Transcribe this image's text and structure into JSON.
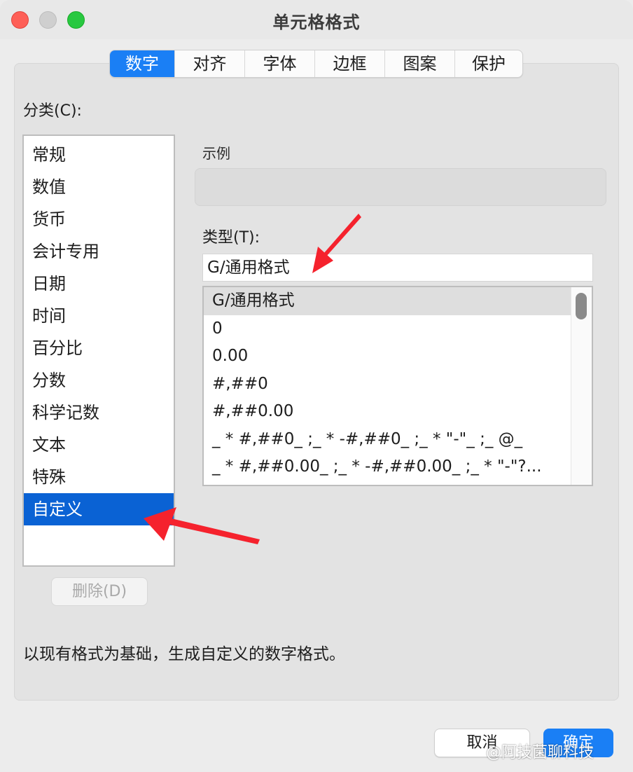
{
  "window": {
    "title": "单元格格式"
  },
  "tabs": [
    {
      "label": "数字",
      "active": true
    },
    {
      "label": "对齐",
      "active": false
    },
    {
      "label": "字体",
      "active": false
    },
    {
      "label": "边框",
      "active": false
    },
    {
      "label": "图案",
      "active": false
    },
    {
      "label": "保护",
      "active": false
    }
  ],
  "category": {
    "label": "分类(C):",
    "items": [
      "常规",
      "数值",
      "货币",
      "会计专用",
      "日期",
      "时间",
      "百分比",
      "分数",
      "科学记数",
      "文本",
      "特殊",
      "自定义"
    ],
    "selected_index": 11,
    "delete_label": "删除(D)"
  },
  "sample": {
    "label": "示例",
    "value": ""
  },
  "type": {
    "label": "类型(T):",
    "input_value": "G/通用格式",
    "items": [
      "G/通用格式",
      "0",
      "0.00",
      "#,##0",
      "#,##0.00",
      "_ * #,##0_ ;_ * -#,##0_ ;_ * \"-\"_ ;_ @_",
      "_ * #,##0.00_ ;_ * -#,##0.00_ ;_ * \"-\"?..."
    ],
    "selected_index": 0
  },
  "description": "以现有格式为基础，生成自定义的数字格式。",
  "buttons": {
    "cancel": "取消",
    "ok": "确定"
  },
  "watermark": "@阿技菌聊科技",
  "colors": {
    "accent": "#1a7ff5",
    "selection": "#0a62d4",
    "arrow": "#f5222d"
  }
}
